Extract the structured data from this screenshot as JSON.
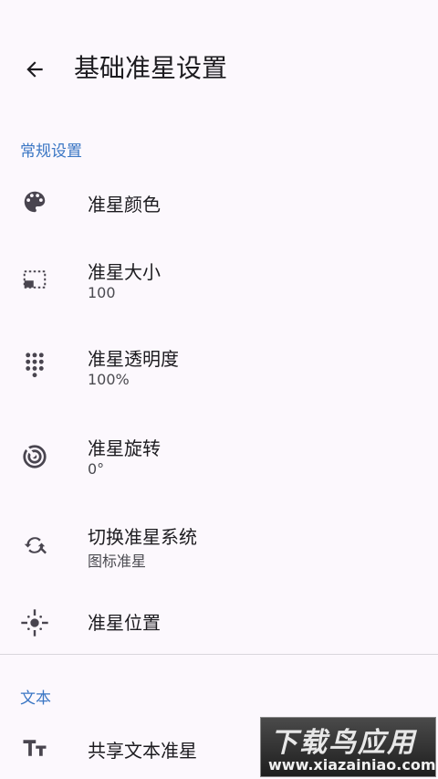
{
  "header": {
    "title": "基础准星设置",
    "back_icon": "arrow-back-icon"
  },
  "sections": {
    "general": "常规设置",
    "text": "文本"
  },
  "items": [
    {
      "label": "准星颜色",
      "sub": "",
      "icon": "palette-icon"
    },
    {
      "label": "准星大小",
      "sub": "100",
      "icon": "resize-icon"
    },
    {
      "label": "准星透明度",
      "sub": "100%",
      "icon": "dots-grid-icon"
    },
    {
      "label": "准星旋转",
      "sub": "0°",
      "icon": "target-icon"
    },
    {
      "label": "切换准星系统",
      "sub": "图标准星",
      "icon": "switch-icon"
    },
    {
      "label": "准星位置",
      "sub": "",
      "icon": "crosshair-position-icon"
    },
    {
      "label": "共享文本准星",
      "sub": "",
      "icon": "text-size-icon"
    }
  ],
  "watermark": {
    "title": "下载鸟应用",
    "url": "www.xiazainiao.com"
  },
  "colors": {
    "accent": "#3a76c4",
    "background": "#fcf8fd",
    "icon": "#49454f"
  }
}
